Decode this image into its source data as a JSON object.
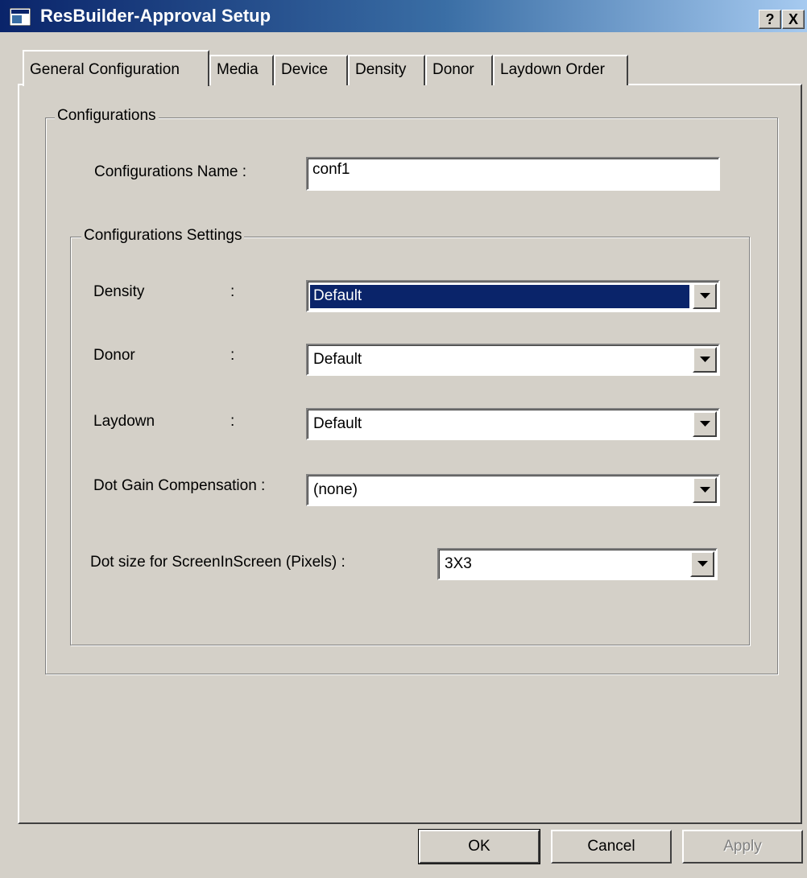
{
  "window": {
    "title": "ResBuilder-Approval Setup",
    "help_label": "?",
    "close_label": "X"
  },
  "tabs": [
    {
      "label": "General Configuration"
    },
    {
      "label": "Media"
    },
    {
      "label": "Device"
    },
    {
      "label": "Density"
    },
    {
      "label": "Donor"
    },
    {
      "label": "Laydown Order"
    }
  ],
  "configurations": {
    "group_label": "Configurations",
    "name_label": "Configurations Name  :",
    "name_value": "conf1"
  },
  "settings": {
    "group_label": "Configurations Settings",
    "density_label": "Density",
    "density_value": "Default",
    "donor_label": "Donor",
    "donor_value": "Default",
    "laydown_label": "Laydown",
    "laydown_value": "Default",
    "colon": ":",
    "dot_gain_label": "Dot Gain Compensation :",
    "dot_gain_value": "(none)",
    "dot_size_label": "Dot size for ScreenInScreen (Pixels) :",
    "dot_size_value": "3X3"
  },
  "buttons": {
    "ok": "OK",
    "cancel": "Cancel",
    "apply": "Apply"
  },
  "colors": {
    "titlebar_start": "#0a246a",
    "titlebar_end": "#a6caf0",
    "selection": "#0a246a",
    "face": "#d4d0c8"
  }
}
